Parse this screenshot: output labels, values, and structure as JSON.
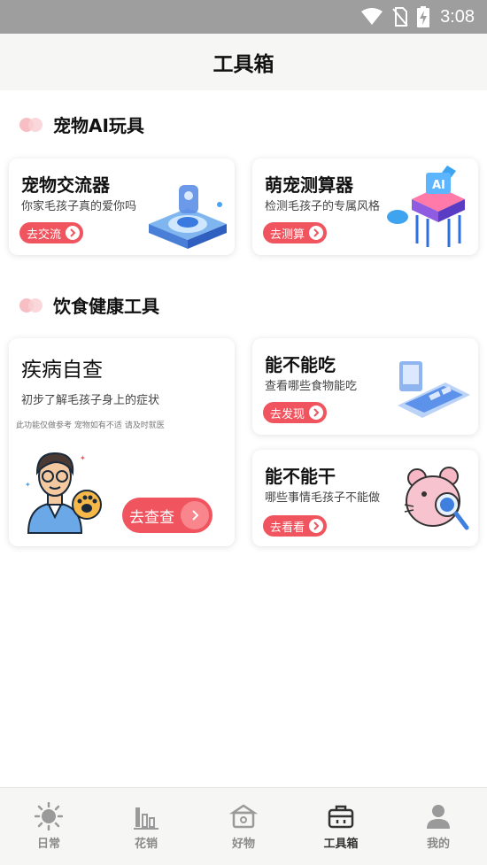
{
  "status_bar": {
    "time": "3:08"
  },
  "header": {
    "title": "工具箱"
  },
  "sections": [
    {
      "label": "宠物AI玩具"
    },
    {
      "label": "饮食健康工具"
    }
  ],
  "cards": {
    "pet_translator": {
      "title": "宠物交流器",
      "subtitle": "你家毛孩子真的爱你吗",
      "button": "去交流"
    },
    "pet_calculator": {
      "title": "萌宠测算器",
      "subtitle": "检测毛孩子的专属风格",
      "button": "去测算"
    },
    "disease_check": {
      "title": "疾病自查",
      "subtitle": "初步了解毛孩子身上的症状",
      "note": "此功能仅做参考 宠物如有不适 请及时就医",
      "button": "去查查"
    },
    "can_eat": {
      "title": "能不能吃",
      "subtitle": "查看哪些食物能吃",
      "button": "去发现"
    },
    "can_do": {
      "title": "能不能干",
      "subtitle": "哪些事情毛孩子不能做",
      "button": "去看看"
    }
  },
  "bottom_nav": {
    "items": [
      {
        "label": "日常",
        "icon": "sun-icon"
      },
      {
        "label": "花销",
        "icon": "chart-icon"
      },
      {
        "label": "好物",
        "icon": "box-icon"
      },
      {
        "label": "工具箱",
        "icon": "toolbox-icon",
        "active": true
      },
      {
        "label": "我的",
        "icon": "user-icon"
      }
    ]
  },
  "colors": {
    "accent": "#f0545e",
    "active_nav": "#333333",
    "inactive_nav": "#8a8a8a"
  }
}
